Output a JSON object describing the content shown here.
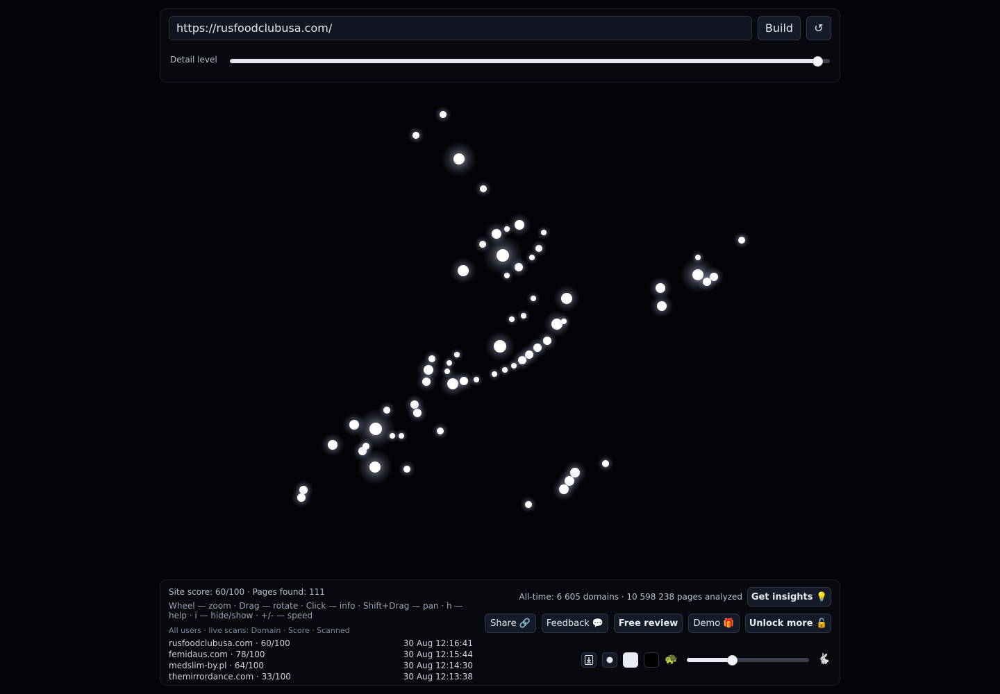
{
  "url_input": {
    "value": "https://rusfoodclubusa.com/"
  },
  "buttons": {
    "build": "Build",
    "reset": "↺",
    "get_insights": "Get insights 💡",
    "share": "Share 🔗",
    "feedback": "Feedback 💬",
    "free_review": "Free review",
    "demo": "Demo 🎁",
    "unlock_more": "Unlock more 🔓"
  },
  "detail": {
    "label": "Detail level",
    "value": 0.98
  },
  "stats": {
    "site_score": "Site score: 60/100 · Pages found: 111",
    "help": "Wheel — zoom · Drag — rotate · Click — info · Shift+Drag — pan · h — help · i — hide/show · +/- — speed",
    "live_title": "All users · live scans: Domain · Score · Scanned",
    "alltime": "All-time: 6 605 domains · 10 598 238 pages analyzed"
  },
  "scans": [
    {
      "domain": "rusfoodclubusa.com · 60/100",
      "time": "30 Aug 12:16:41"
    },
    {
      "domain": "femidaus.com · 78/100",
      "time": "30 Aug 12:15:44"
    },
    {
      "domain": "medslim-by.pl · 64/100",
      "time": "30 Aug 12:14:30"
    },
    {
      "domain": "themirrordance.com · 33/100",
      "time": "30 Aug 12:13:38"
    }
  ],
  "speed": {
    "value": 0.37
  },
  "icons": {
    "download": "download-icon",
    "dot_small": "dot-small-icon",
    "dot_large": "dot-large-icon",
    "bg_dark": "dark-background-icon",
    "turtle": "turtle-icon",
    "rabbit": "rabbit-icon"
  },
  "colors": {
    "background": "#030408",
    "node": "#ffffff",
    "panel": "#07090f"
  }
}
